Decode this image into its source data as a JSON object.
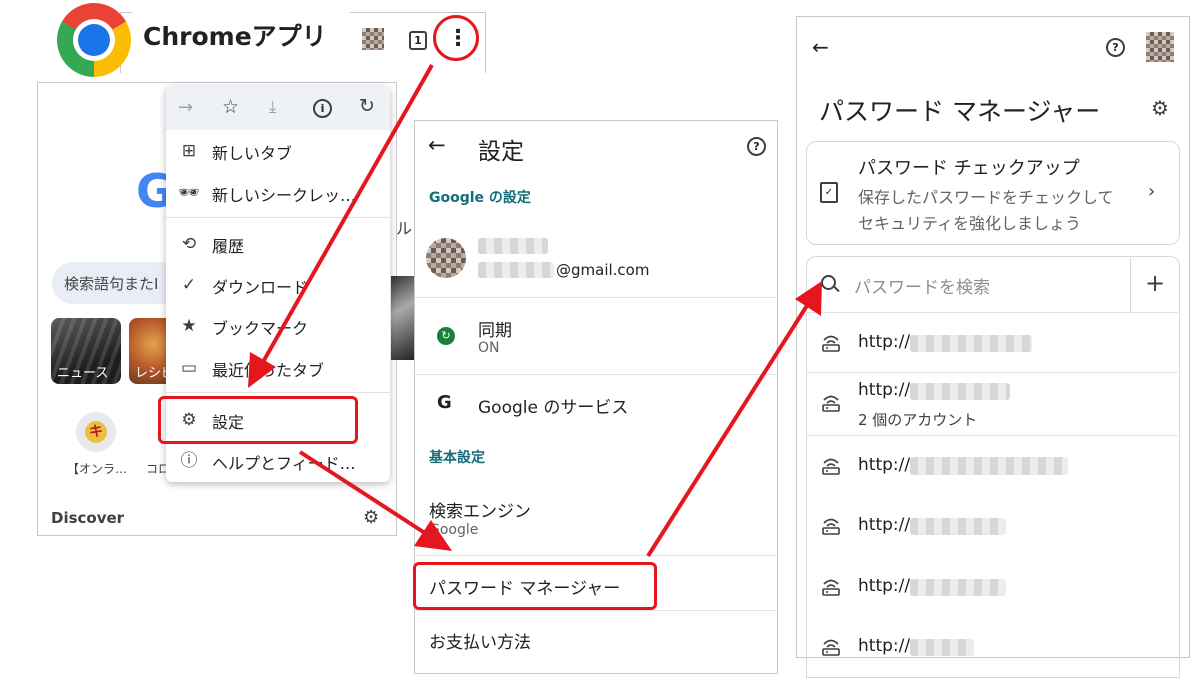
{
  "heading": {
    "label": "Chromeアプリ"
  },
  "chrome_top": {
    "tab_count": "1"
  },
  "menu": {
    "items": [
      {
        "label": "新しいタブ"
      },
      {
        "label": "新しいシークレッ…"
      },
      {
        "label": "履歴"
      },
      {
        "label": "ダウンロード"
      },
      {
        "label": "ブックマーク"
      },
      {
        "label": "最近使ったタブ"
      },
      {
        "label": "設定"
      },
      {
        "label": "ヘルプとフィード…"
      }
    ]
  },
  "home": {
    "search_placeholder": "検索語句またI",
    "tiles": [
      {
        "label": "ニュース"
      },
      {
        "label": "レシピ"
      }
    ],
    "shortcuts": [
      {
        "label": "【オンラ…"
      },
      {
        "label": "コロ"
      }
    ],
    "shortcut_badge": "キ",
    "discover": "Discover"
  },
  "settings": {
    "title": "設定",
    "google_section": "Google の設定",
    "account_email_suffix": "@gmail.com",
    "sync_label": "同期",
    "sync_status": "ON",
    "google_services": "Google のサービス",
    "basic_section": "基本設定",
    "search_engine_label": "検索エンジン",
    "search_engine_value": "Google",
    "password_manager": "パスワード マネージャー",
    "payment_methods": "お支払い方法"
  },
  "password_manager": {
    "title": "パスワード マネージャー",
    "checkup_title": "パスワード チェックアップ",
    "checkup_desc_1": "保存したパスワードをチェックして",
    "checkup_desc_2": "セキュリティを強化しましょう",
    "search_placeholder": "パスワードを検索",
    "entries": [
      {
        "url": "http://"
      },
      {
        "url": "http://",
        "sub": "2 個のアカウント"
      },
      {
        "url": "http://"
      },
      {
        "url": "http://"
      },
      {
        "url": "http://"
      },
      {
        "url": "http://"
      }
    ]
  },
  "colors": {
    "accent_red": "#e5161d",
    "link_teal": "#146c78",
    "sync_green": "#188038"
  }
}
